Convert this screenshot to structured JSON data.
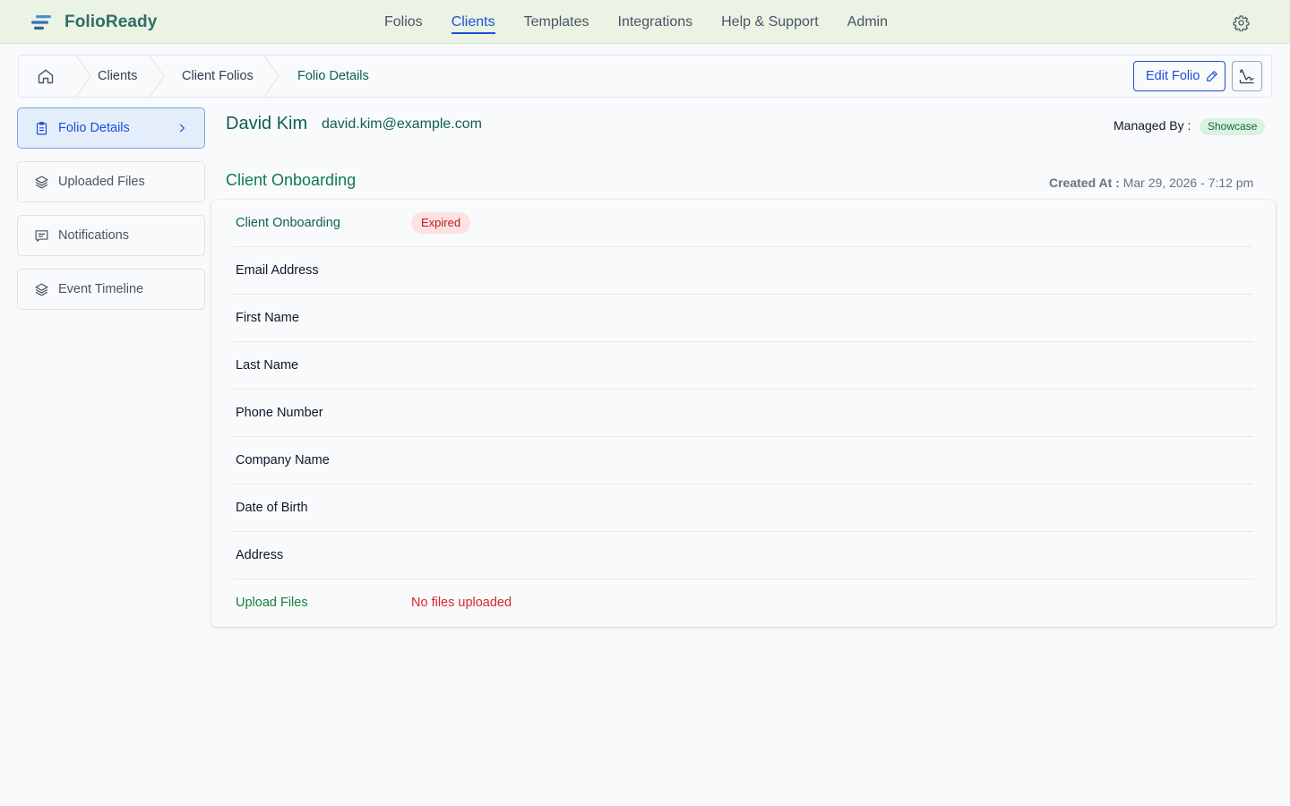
{
  "app": {
    "brand": "FolioReady"
  },
  "nav": {
    "items": [
      "Folios",
      "Clients",
      "Templates",
      "Integrations",
      "Help & Support",
      "Admin"
    ],
    "active": "Clients"
  },
  "breadcrumb": [
    "Clients",
    "Client Folios",
    "Folio Details"
  ],
  "actions": {
    "edit_label": "Edit Folio"
  },
  "sidebar": {
    "items": [
      {
        "label": "Folio Details",
        "icon": "clipboard-icon",
        "active": true
      },
      {
        "label": "Uploaded Files",
        "icon": "layers-icon"
      },
      {
        "label": "Notifications",
        "icon": "message-icon"
      },
      {
        "label": "Event Timeline",
        "icon": "layers-icon"
      }
    ]
  },
  "client": {
    "name": "David Kim",
    "email": "david.kim@example.com",
    "managed_by_label": "Managed By :",
    "managed_by": "Showcase"
  },
  "section": {
    "title": "Client Onboarding",
    "created_label": "Created At :",
    "created_value": "Mar 29, 2026 - 7:12 pm"
  },
  "fields": {
    "status_label": "Client Onboarding",
    "status": "Expired",
    "rows": [
      "Email Address",
      "First Name",
      "Last Name",
      "Phone Number",
      "Company Name",
      "Date of Birth",
      "Address"
    ],
    "upload_label": "Upload Files",
    "upload_value": "No files uploaded"
  },
  "colors": {
    "topbar": "#eaf3e4",
    "brand": "#2f6e63",
    "accent": "#1d4ed8",
    "green_text": "#0f5f53",
    "expired_bg": "#fde2e2",
    "expired_text": "#b91c1c"
  }
}
